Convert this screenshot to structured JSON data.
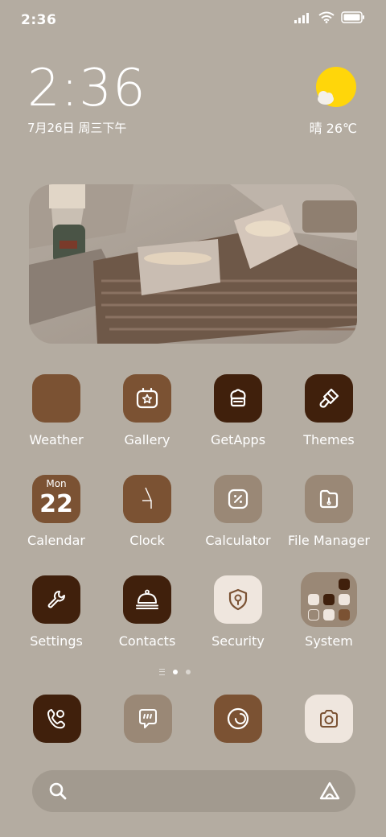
{
  "status_bar": {
    "time": "2:36",
    "icons": [
      "signal-icon",
      "wifi-icon",
      "battery-icon"
    ]
  },
  "clock_widget": {
    "time": "2:36",
    "date": "7月26日 周三下午"
  },
  "weather_widget": {
    "condition": "晴",
    "temperature": "26℃",
    "icon": "sun-cloud-icon"
  },
  "photo_widget": {
    "description_icon": "photo"
  },
  "apps": [
    {
      "label": "Weather",
      "icon": "weather-icon"
    },
    {
      "label": "Gallery",
      "icon": "gallery-icon"
    },
    {
      "label": "GetApps",
      "icon": "getapps-icon"
    },
    {
      "label": "Themes",
      "icon": "themes-icon"
    },
    {
      "label": "Calendar",
      "icon": "calendar-icon",
      "day": "Mon",
      "date": "22"
    },
    {
      "label": "Clock",
      "icon": "clock-icon"
    },
    {
      "label": "Calculator",
      "icon": "calculator-icon"
    },
    {
      "label": "File Manager",
      "icon": "file-manager-icon"
    },
    {
      "label": "Settings",
      "icon": "settings-icon"
    },
    {
      "label": "Contacts",
      "icon": "contacts-icon"
    },
    {
      "label": "Security",
      "icon": "security-icon"
    },
    {
      "label": "System",
      "icon": "system-folder-icon"
    }
  ],
  "page_indicator": {
    "pages": 2,
    "active": 1
  },
  "dock": [
    {
      "name": "phone",
      "icon": "phone-icon"
    },
    {
      "name": "messages",
      "icon": "messages-icon"
    },
    {
      "name": "browser",
      "icon": "browser-icon"
    },
    {
      "name": "camera",
      "icon": "camera-icon"
    }
  ],
  "search": {
    "icon": "search-icon",
    "assistant_icon": "assistant-icon"
  },
  "colors": {
    "background": "#b4aca1",
    "brown": "#7b5233",
    "dark_brown": "#40200c",
    "tan": "#9a8876",
    "cream": "#efe6de",
    "sun": "#ffd60a"
  }
}
